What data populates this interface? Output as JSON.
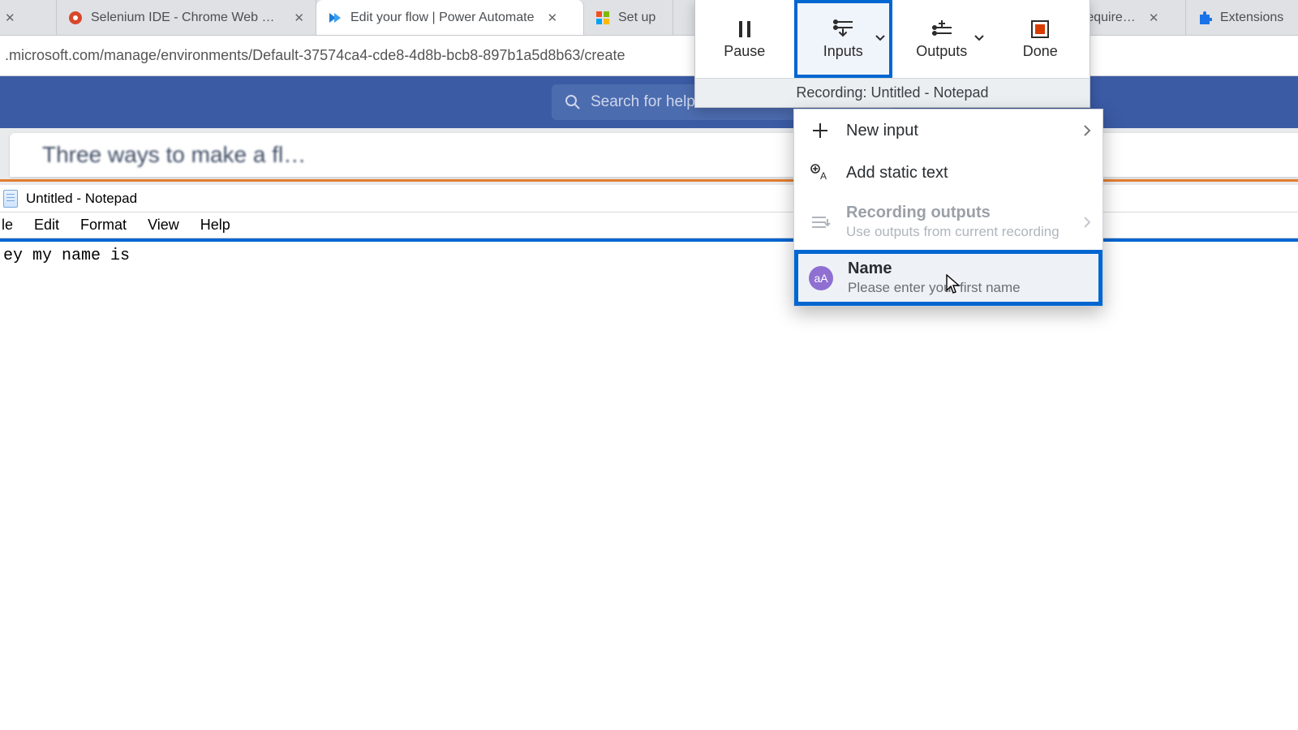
{
  "tabs": [
    {
      "label": ""
    },
    {
      "label": "Selenium IDE - Chrome Web Sto…"
    },
    {
      "label": "Edit your flow | Power Automate"
    },
    {
      "label": "Set up"
    },
    {
      "label": "require…"
    },
    {
      "label": "Extensions"
    }
  ],
  "address_bar": {
    "url": ".microsoft.com/manage/environments/Default-37574ca4-cde8-4d8b-bcb8-897b1a5d8b63/create"
  },
  "page": {
    "search_placeholder": "Search for helpful resources",
    "heading": "Three ways to make a fl…"
  },
  "notepad": {
    "title": "Untitled - Notepad",
    "menus": [
      "le",
      "Edit",
      "Format",
      "View",
      "Help"
    ],
    "body": "ey my name is"
  },
  "recorder": {
    "buttons": {
      "pause": "Pause",
      "inputs": "Inputs",
      "outputs": "Outputs",
      "done": "Done"
    },
    "status": "Recording: Untitled - Notepad"
  },
  "dropdown": {
    "new_input": "New input",
    "add_static": "Add static text",
    "rec_outputs_title": "Recording outputs",
    "rec_outputs_sub": "Use outputs from current recording",
    "name_title": "Name",
    "name_sub": "Please enter your first name",
    "name_icon_text": "aA"
  }
}
